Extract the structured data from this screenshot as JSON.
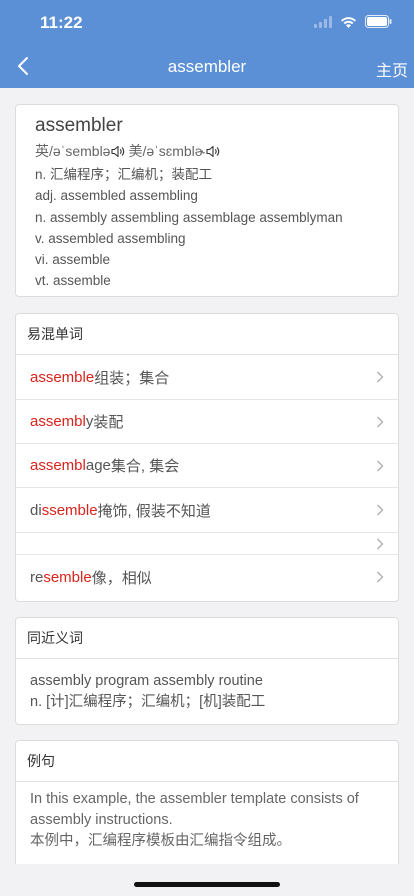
{
  "status": {
    "time": "11:22"
  },
  "nav": {
    "title": "assembler",
    "home": "主页"
  },
  "word": {
    "headword": "assembler",
    "phonetic_uk": "英/əˈsemblə",
    "phonetic_us": "美/əˈsɛmblɚ",
    "definitions": [
      "n. 汇编程序；汇编机；装配工",
      "adj. assembled assembling",
      "n. assembly assembling assemblage assemblyman",
      "v. assembled assembling",
      "vi. assemble",
      "vt. assemble"
    ]
  },
  "confusables": {
    "title": "易混单词",
    "items": [
      {
        "pre": "",
        "red": "assemble",
        "post": "",
        "meaning": " 组装；集合"
      },
      {
        "pre": "",
        "red": "assembl",
        "post": "y",
        "meaning": " 装配"
      },
      {
        "pre": "",
        "red": "assembl",
        "post": "age",
        "meaning": " 集合, 集会"
      },
      {
        "pre": "di",
        "red": "ssemble",
        "post": "",
        "meaning": " 掩饰, 假装不知道"
      },
      {
        "pre": "",
        "red": "",
        "post": "",
        "meaning": ""
      },
      {
        "pre": "re",
        "red": "semble",
        "post": "",
        "meaning": " 像，相似"
      }
    ]
  },
  "synonyms": {
    "title": "同近义词",
    "line1": "assembly program assembly routine",
    "line2": "n. [计]汇编程序；汇编机；[机]装配工"
  },
  "examples": {
    "title": "例句",
    "en": "In this example, the assembler template consists of assembly instructions.",
    "zh": "本例中，汇编程序模板由汇编指令组成。"
  },
  "colors": {
    "header": "#5b8fd6",
    "highlight": "#d9231b"
  }
}
